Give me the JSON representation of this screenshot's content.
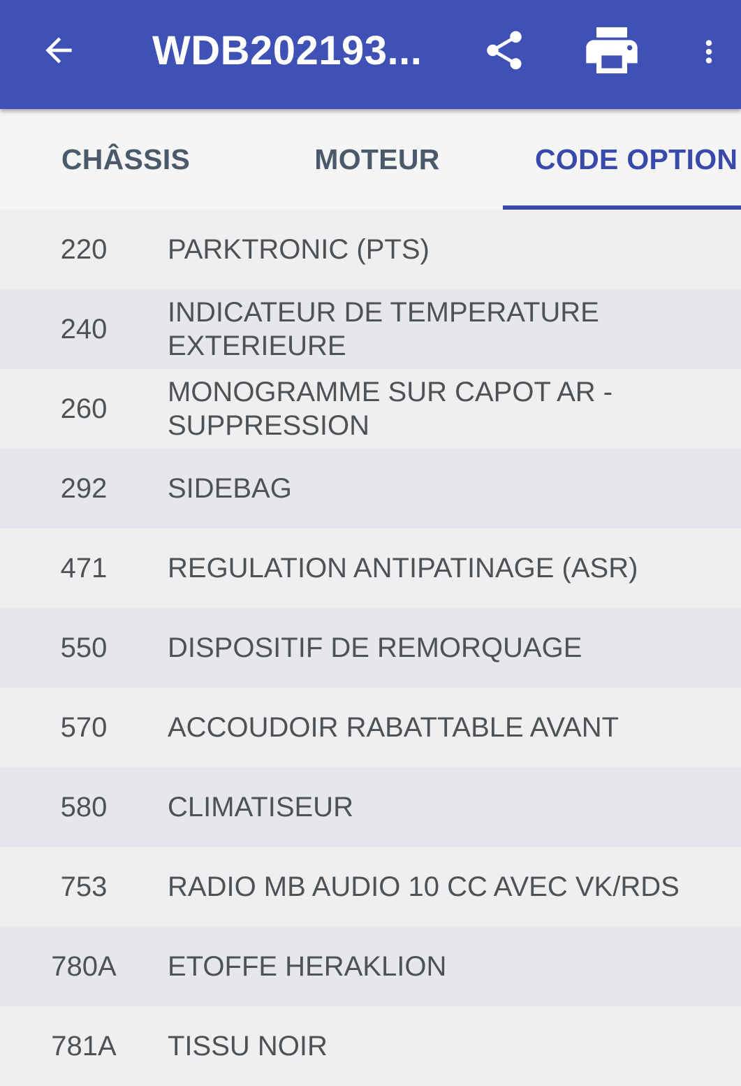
{
  "appbar": {
    "title": "WDB202193...",
    "back_icon": "arrow-left-icon",
    "share_icon": "share-icon",
    "print_icon": "print-icon",
    "more_icon": "more-vert-icon",
    "background": "#3f51b5"
  },
  "tabs": [
    {
      "label": "CHÂSSIS",
      "active": false
    },
    {
      "label": "MOTEUR",
      "active": false
    },
    {
      "label": "CODE OPTION",
      "active": true
    }
  ],
  "accent": "#3949ab",
  "options": [
    {
      "code": "220",
      "desc": "PARKTRONIC (PTS)"
    },
    {
      "code": "240",
      "desc": "INDICATEUR DE TEMPERATURE\nEXTERIEURE"
    },
    {
      "code": "260",
      "desc": "MONOGRAMME SUR CAPOT AR -\nSUPPRESSION"
    },
    {
      "code": "292",
      "desc": "SIDEBAG"
    },
    {
      "code": "471",
      "desc": "REGULATION ANTIPATINAGE (ASR)"
    },
    {
      "code": "550",
      "desc": "DISPOSITIF DE REMORQUAGE"
    },
    {
      "code": "570",
      "desc": "ACCOUDOIR RABATTABLE AVANT"
    },
    {
      "code": "580",
      "desc": "CLIMATISEUR"
    },
    {
      "code": "753",
      "desc": "RADIO MB AUDIO 10 CC AVEC VK/RDS"
    },
    {
      "code": "780A",
      "desc": "ETOFFE HERAKLION"
    },
    {
      "code": "781A",
      "desc": "TISSU NOIR"
    }
  ]
}
